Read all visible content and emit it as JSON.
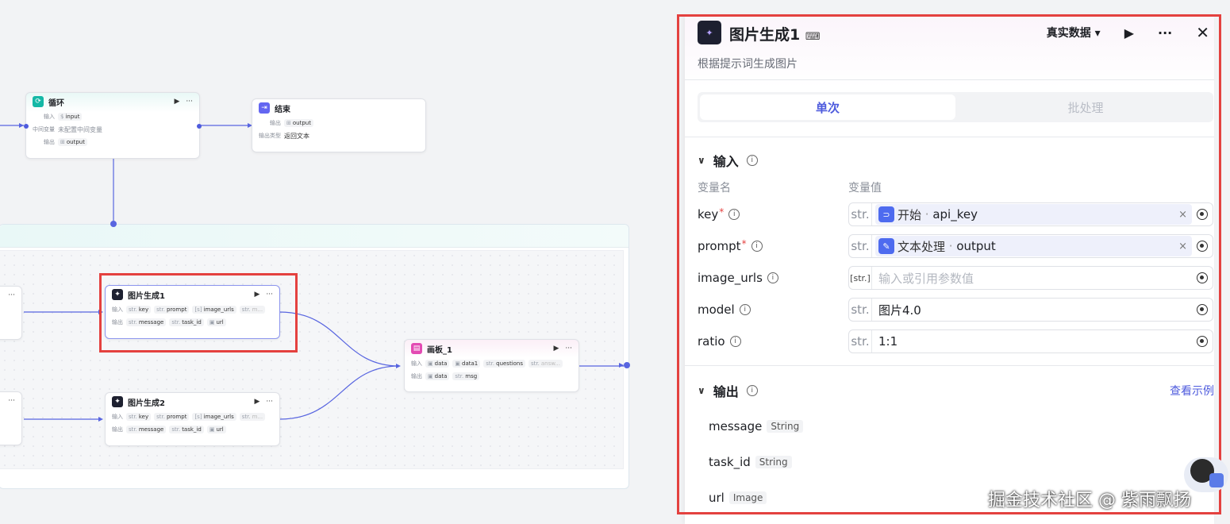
{
  "canvas": {
    "loop_node": {
      "title": "循环",
      "rows": [
        {
          "label": "输入",
          "chips": [
            {
              "t": "$",
              "v": "input"
            }
          ]
        },
        {
          "label": "中间变量",
          "text": "未配置中间变量"
        },
        {
          "label": "输出",
          "chips": [
            {
              "t": "⊞",
              "v": "output"
            }
          ]
        }
      ]
    },
    "end_node": {
      "title": "结束",
      "rows": [
        {
          "label": "输出",
          "chips": [
            {
              "t": "⊞",
              "v": "output"
            }
          ]
        },
        {
          "label": "输出类型",
          "text": "返回文本"
        }
      ]
    },
    "img1_node": {
      "title": "图片生成1",
      "in": [
        "key",
        "prompt",
        "image_urls",
        "m..."
      ],
      "out": [
        "message",
        "task_id",
        "url"
      ]
    },
    "img2_node": {
      "title": "图片生成2",
      "in": [
        "key",
        "prompt",
        "image_urls",
        "m..."
      ],
      "out": [
        "message",
        "task_id",
        "url"
      ]
    },
    "board_node": {
      "title": "画板_1",
      "in": [
        "data",
        "data1",
        "questions",
        "answ..."
      ],
      "out": [
        "data",
        "msg"
      ]
    },
    "labels": {
      "in": "输入",
      "out": "输出",
      "str": "str.",
      "more": "···"
    }
  },
  "panel": {
    "title": "图片生成1",
    "subtitle": "根据提示词生成图片",
    "data_mode": "真实数据",
    "tabs": [
      {
        "label": "单次",
        "active": true
      },
      {
        "label": "批处理",
        "active": false
      }
    ],
    "input_section": "输入",
    "col_name": "变量名",
    "col_value": "变量值",
    "params": [
      {
        "name": "key",
        "required": true,
        "type": "str.",
        "ref_node": "开始",
        "ref_var": "api_key"
      },
      {
        "name": "prompt",
        "required": true,
        "type": "str.",
        "ref_node": "文本处理",
        "ref_var": "output"
      },
      {
        "name": "image_urls",
        "required": false,
        "type": "[str.]",
        "placeholder": "输入或引用参数值"
      },
      {
        "name": "model",
        "required": false,
        "type": "str.",
        "value": "图片4.0"
      },
      {
        "name": "ratio",
        "required": false,
        "type": "str.",
        "value": "1:1"
      }
    ],
    "output_section": "输出",
    "view_example": "查看示例",
    "outputs": [
      {
        "name": "message",
        "type": "String"
      },
      {
        "name": "task_id",
        "type": "String"
      },
      {
        "name": "url",
        "type": "Image"
      }
    ]
  },
  "watermark": "掘金技术社区 @ 紫雨飘扬",
  "colors": {
    "accent": "#4e5bdd",
    "highlight": "#e4413f",
    "loop_icon": "#14b8a6",
    "end_icon": "#6366f1",
    "board_icon": "#e34bb3"
  }
}
